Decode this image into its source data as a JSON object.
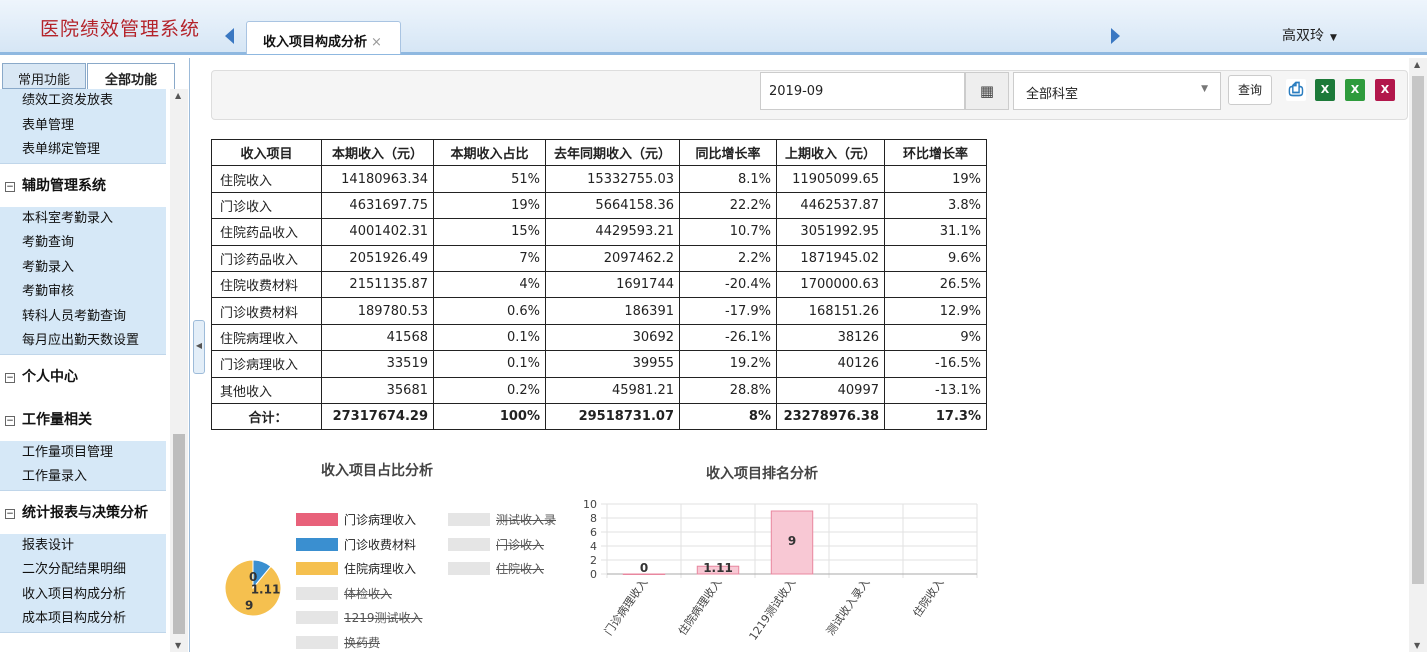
{
  "header": {
    "app_title": "医院绩效管理系统",
    "active_tab": "收入项目构成分析",
    "tab_close": "×",
    "user_name": "高双玲"
  },
  "sidebar": {
    "tab_common": "常用功能",
    "tab_all": "全部功能",
    "groups": [
      {
        "title": "",
        "items": [
          "绩效工资发放表",
          "表单管理",
          "表单绑定管理"
        ]
      },
      {
        "title": "辅助管理系统",
        "items": [
          "本科室考勤录入",
          "考勤查询",
          "考勤录入",
          "考勤审核",
          "转科人员考勤查询",
          "每月应出勤天数设置"
        ]
      },
      {
        "title": "个人中心",
        "items": []
      },
      {
        "title": "工作量相关",
        "items": [
          "工作量项目管理",
          "工作量录入"
        ]
      },
      {
        "title": "统计报表与决策分析",
        "items": [
          "报表设计",
          "二次分配结果明细",
          "收入项目构成分析",
          "成本项目构成分析"
        ]
      }
    ]
  },
  "toolbar": {
    "period": "2019-09",
    "department": "全部科室",
    "query_label": "查询",
    "calendar_icon": "calendar-icon",
    "print_icon": "print-icon",
    "excel_icon": "excel-icon"
  },
  "table": {
    "headers": [
      "收入项目",
      "本期收入（元）",
      "本期收入占比",
      "去年同期收入（元）",
      "同比增长率",
      "上期收入（元）",
      "环比增长率"
    ],
    "rows": [
      [
        "住院收入",
        "14180963.34",
        "51%",
        "15332755.03",
        "8.1%",
        "11905099.65",
        "19%"
      ],
      [
        "门诊收入",
        "4631697.75",
        "19%",
        "5664158.36",
        "22.2%",
        "4462537.87",
        "3.8%"
      ],
      [
        "住院药品收入",
        "4001402.31",
        "15%",
        "4429593.21",
        "10.7%",
        "3051992.95",
        "31.1%"
      ],
      [
        "门诊药品收入",
        "2051926.49",
        "7%",
        "2097462.2",
        "2.2%",
        "1871945.02",
        "9.6%"
      ],
      [
        "住院收费材料",
        "2151135.87",
        "4%",
        "1691744",
        "-20.4%",
        "1700000.63",
        "26.5%"
      ],
      [
        "门诊收费材料",
        "189780.53",
        "0.6%",
        "186391",
        "-17.9%",
        "168151.26",
        "12.9%"
      ],
      [
        "住院病理收入",
        "41568",
        "0.1%",
        "30692",
        "-26.1%",
        "38126",
        "9%"
      ],
      [
        "门诊病理收入",
        "33519",
        "0.1%",
        "39955",
        "19.2%",
        "40126",
        "-16.5%"
      ],
      [
        "其他收入",
        "35681",
        "0.2%",
        "45981.21",
        "28.8%",
        "40997",
        "-13.1%"
      ]
    ],
    "total": [
      "合计：",
      "27317674.29",
      "100%",
      "29518731.07",
      "8%",
      "23278976.38",
      "17.3%"
    ]
  },
  "chart_data": [
    {
      "type": "pie",
      "title": "收入项目占比分析",
      "legend": [
        {
          "name": "门诊病理收入",
          "color": "#e8617a",
          "active": true
        },
        {
          "name": "测试收入录",
          "color": "#e5e5e5",
          "active": false
        },
        {
          "name": "门诊收费材料",
          "color": "#3a8fd0",
          "active": true
        },
        {
          "name": "门诊收入",
          "color": "#e5e5e5",
          "active": false
        },
        {
          "name": "住院病理收入",
          "color": "#f5c04f",
          "active": true
        },
        {
          "name": "住院收入",
          "color": "#e5e5e5",
          "active": false
        },
        {
          "name": "体检收入",
          "color": "#e5e5e5",
          "active": false
        },
        {
          "name": "1219测试收入",
          "color": "#e5e5e5",
          "active": false
        },
        {
          "name": "换药费",
          "color": "#e5e5e5",
          "active": false
        }
      ],
      "slices": [
        {
          "name": "门诊病理收入",
          "value": 0,
          "label": "0",
          "color": "#e8617a"
        },
        {
          "name": "门诊收费材料",
          "value": 1.11,
          "label": "1.11",
          "color": "#3a8fd0"
        },
        {
          "name": "住院病理收入",
          "value": 9,
          "label": "9",
          "color": "#f5c04f"
        }
      ]
    },
    {
      "type": "bar",
      "title": "收入项目排名分析",
      "categories": [
        "门诊病理收入",
        "住院病理收入",
        "1219测试收入",
        "测试收入录入",
        "住院收入"
      ],
      "values": [
        0,
        1.11,
        9,
        null,
        null
      ],
      "labels": [
        "0",
        "1.11",
        "9",
        "",
        ""
      ],
      "ylim": [
        0,
        10
      ],
      "yticks": [
        "0",
        "2",
        "4",
        "6",
        "8",
        "10"
      ],
      "bar_fill": "#f8c8d4",
      "bar_stroke": "#e8879f"
    }
  ]
}
